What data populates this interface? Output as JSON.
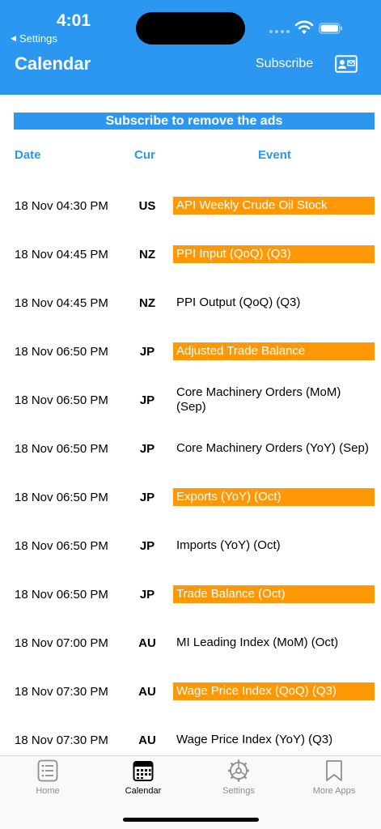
{
  "status": {
    "time": "4:01",
    "back_label": "Settings"
  },
  "header": {
    "title": "Calendar",
    "subscribe_label": "Subscribe",
    "contact_icon": "contact-card-icon"
  },
  "banner": {
    "text": "Subscribe to remove the ads"
  },
  "columns": {
    "date": "Date",
    "currency": "Cur",
    "event": "Event"
  },
  "events": [
    {
      "date": "18 Nov 04:30 PM",
      "currency": "US",
      "event": "API Weekly Crude Oil Stock",
      "highlighted": true
    },
    {
      "date": "18 Nov 04:45 PM",
      "currency": "NZ",
      "event": "PPI Input (QoQ) (Q3)",
      "highlighted": true
    },
    {
      "date": "18 Nov 04:45 PM",
      "currency": "NZ",
      "event": "PPI Output (QoQ) (Q3)",
      "highlighted": false
    },
    {
      "date": "18 Nov 06:50 PM",
      "currency": "JP",
      "event": "Adjusted Trade Balance",
      "highlighted": true
    },
    {
      "date": "18 Nov 06:50 PM",
      "currency": "JP",
      "event": "Core Machinery Orders (MoM) (Sep)",
      "highlighted": false
    },
    {
      "date": "18 Nov 06:50 PM",
      "currency": "JP",
      "event": "Core Machinery Orders (YoY) (Sep)",
      "highlighted": false
    },
    {
      "date": "18 Nov 06:50 PM",
      "currency": "JP",
      "event": "Exports (YoY) (Oct)",
      "highlighted": true
    },
    {
      "date": "18 Nov 06:50 PM",
      "currency": "JP",
      "event": "Imports (YoY) (Oct)",
      "highlighted": false
    },
    {
      "date": "18 Nov 06:50 PM",
      "currency": "JP",
      "event": "Trade Balance (Oct)",
      "highlighted": true
    },
    {
      "date": "18 Nov 07:00 PM",
      "currency": "AU",
      "event": "MI Leading Index (MoM) (Oct)",
      "highlighted": false
    },
    {
      "date": "18 Nov 07:30 PM",
      "currency": "AU",
      "event": "Wage Price Index (QoQ) (Q3)",
      "highlighted": true
    },
    {
      "date": "18 Nov 07:30 PM",
      "currency": "AU",
      "event": "Wage Price Index (YoY) (Q3)",
      "highlighted": false
    }
  ],
  "tabs": [
    {
      "label": "Home",
      "icon": "list-icon",
      "active": false
    },
    {
      "label": "Calendar",
      "icon": "calendar-icon",
      "active": true
    },
    {
      "label": "Settings",
      "icon": "gear-icon",
      "active": false
    },
    {
      "label": "More Apps",
      "icon": "bookmark-icon",
      "active": false
    }
  ],
  "colors": {
    "primary": "#2b97f0",
    "highlight": "#ff9806",
    "tab_inactive": "#8e8e93"
  }
}
